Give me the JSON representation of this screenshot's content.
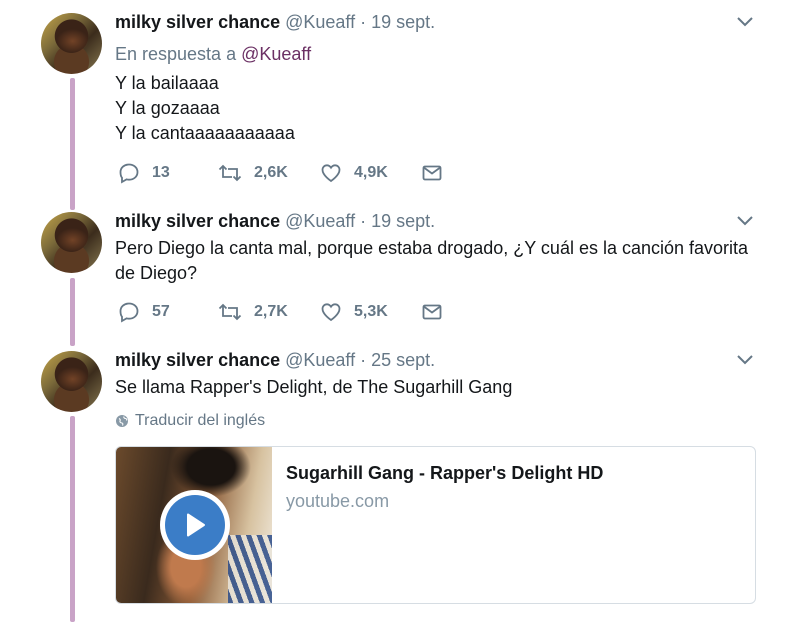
{
  "tweets": [
    {
      "author_name": "milky silver chance",
      "meta": "@Kueaff · 19 sept.",
      "reply_prefix": "En respuesta a",
      "reply_handle": "@Kueaff",
      "text_lines": [
        "Y la bailaaaa",
        "Y la gozaaaa",
        "Y la cantaaaaaaaaaaa"
      ],
      "replies": "13",
      "retweets": "2,6K",
      "likes": "4,9K"
    },
    {
      "author_name": "milky silver chance",
      "meta": "@Kueaff · 19 sept.",
      "text": "Pero Diego la canta mal, porque estaba drogado, ¿Y cuál es la canción favorita de Diego?",
      "replies": "57",
      "retweets": "2,7K",
      "likes": "5,3K"
    },
    {
      "author_name": "milky silver chance",
      "meta": "@Kueaff · 25 sept.",
      "text": "Se llama Rapper's Delight, de The Sugarhill Gang",
      "translate_label": "Traducir del inglés",
      "card": {
        "title": "Sugarhill Gang - Rapper's Delight HD",
        "domain": "youtube.com"
      }
    }
  ],
  "icons": {
    "reply": "reply-icon",
    "retweet": "retweet-icon",
    "like": "heart-icon",
    "dm": "envelope-icon",
    "caret": "chevron-down-icon",
    "globe": "globe-icon",
    "play": "play-icon"
  },
  "colors": {
    "thread_line": "#c9a3c7",
    "muted_text": "#657786",
    "reply_handle": "#6b3064",
    "play_button": "#3b7dc7"
  }
}
